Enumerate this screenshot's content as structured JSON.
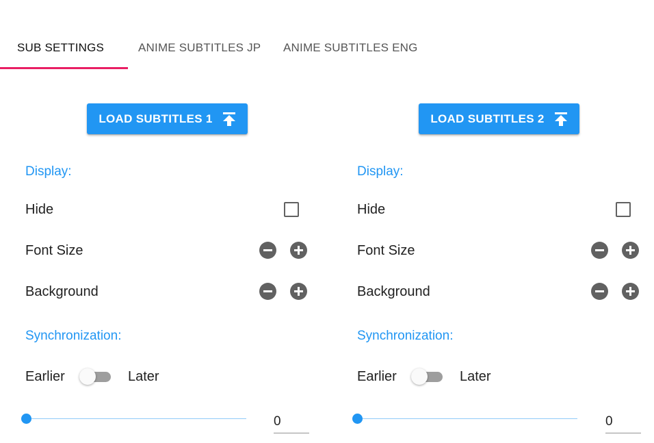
{
  "tabs": [
    {
      "label": "SUB SETTINGS",
      "active": true
    },
    {
      "label": "ANIME SUBTITLES JP",
      "active": false
    },
    {
      "label": "ANIME SUBTITLES ENG",
      "active": false
    }
  ],
  "colors": {
    "accent": "#2196f3",
    "tab_indicator": "#e91e63",
    "icon_gray": "#616161"
  },
  "panels": [
    {
      "load_button": {
        "label": "LOAD SUBTITLES 1",
        "icon": "upload-icon"
      },
      "display_label": "Display:",
      "hide_label": "Hide",
      "hide_checked": false,
      "font_size_label": "Font Size",
      "background_label": "Background",
      "sync_label": "Synchronization:",
      "earlier_label": "Earlier",
      "later_label": "Later",
      "toggle_on": false,
      "slider_value": 0,
      "offset_value": "0"
    },
    {
      "load_button": {
        "label": "LOAD SUBTITLES 2",
        "icon": "upload-icon"
      },
      "display_label": "Display:",
      "hide_label": "Hide",
      "hide_checked": false,
      "font_size_label": "Font Size",
      "background_label": "Background",
      "sync_label": "Synchronization:",
      "earlier_label": "Earlier",
      "later_label": "Later",
      "toggle_on": false,
      "slider_value": 0,
      "offset_value": "0"
    }
  ]
}
